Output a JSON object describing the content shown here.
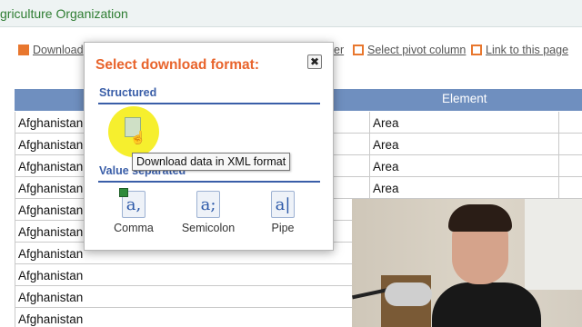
{
  "header": {
    "org_title": "griculture Organization"
  },
  "toolbar": {
    "download_label": "Download",
    "partial_label": "er",
    "pivot_label": "Select pivot column",
    "link_label": "Link to this page"
  },
  "table": {
    "element_header": "Element",
    "rows": [
      {
        "area": "Afghanistan",
        "element": "Area"
      },
      {
        "area": "Afghanistan",
        "element": "Area"
      },
      {
        "area": "Afghanistan",
        "element": "Area"
      },
      {
        "area": "Afghanistan",
        "element": "Area"
      },
      {
        "area": "Afghanistan",
        "element": ""
      },
      {
        "area": "Afghanistan",
        "element": ""
      },
      {
        "area": "Afghanistan",
        "element": ""
      },
      {
        "area": "Afghanistan",
        "element": ""
      },
      {
        "area": "Afghanistan",
        "element": ""
      },
      {
        "area": "Afghanistan",
        "element": ""
      }
    ]
  },
  "modal": {
    "title": "Select download format:",
    "close_glyph": "✖",
    "structured_heading": "Structured",
    "value_separated_heading": "Value separated",
    "formats": [
      {
        "glyph": "a,",
        "label": "Comma"
      },
      {
        "glyph": "a;",
        "label": "Semicolon"
      },
      {
        "glyph": "a|",
        "label": "Pipe"
      }
    ],
    "tooltip": "Download data in XML format"
  },
  "colors": {
    "accent_orange": "#e8642c",
    "header_blue": "#6f8fbf",
    "section_blue": "#3a5ea8",
    "org_green": "#2e7d32"
  }
}
